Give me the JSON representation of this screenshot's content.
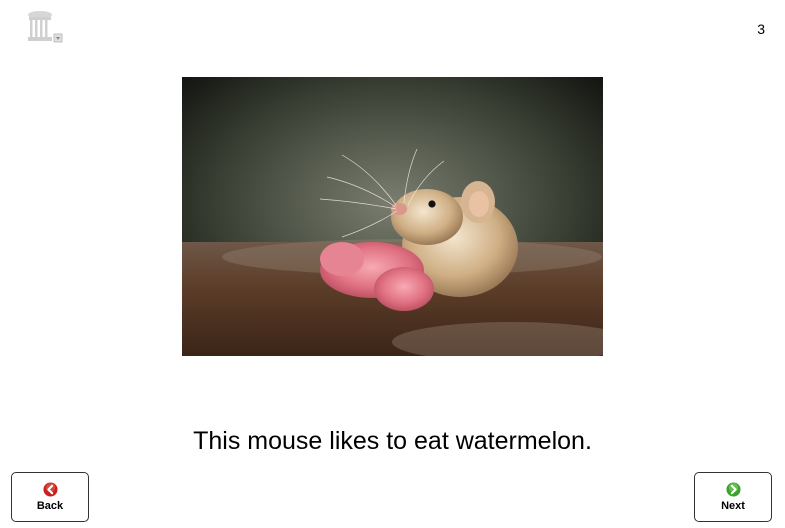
{
  "page": {
    "number": "3"
  },
  "slide": {
    "caption": "This mouse likes to eat watermelon.",
    "image_subject": "mouse eating watermelon"
  },
  "nav": {
    "back_label": "Back",
    "next_label": "Next"
  },
  "icons": {
    "logo": "old-well-logo",
    "back": "back-arrow-icon",
    "next": "next-arrow-icon"
  },
  "colors": {
    "back": "#c8221e",
    "next": "#3aa12a"
  }
}
